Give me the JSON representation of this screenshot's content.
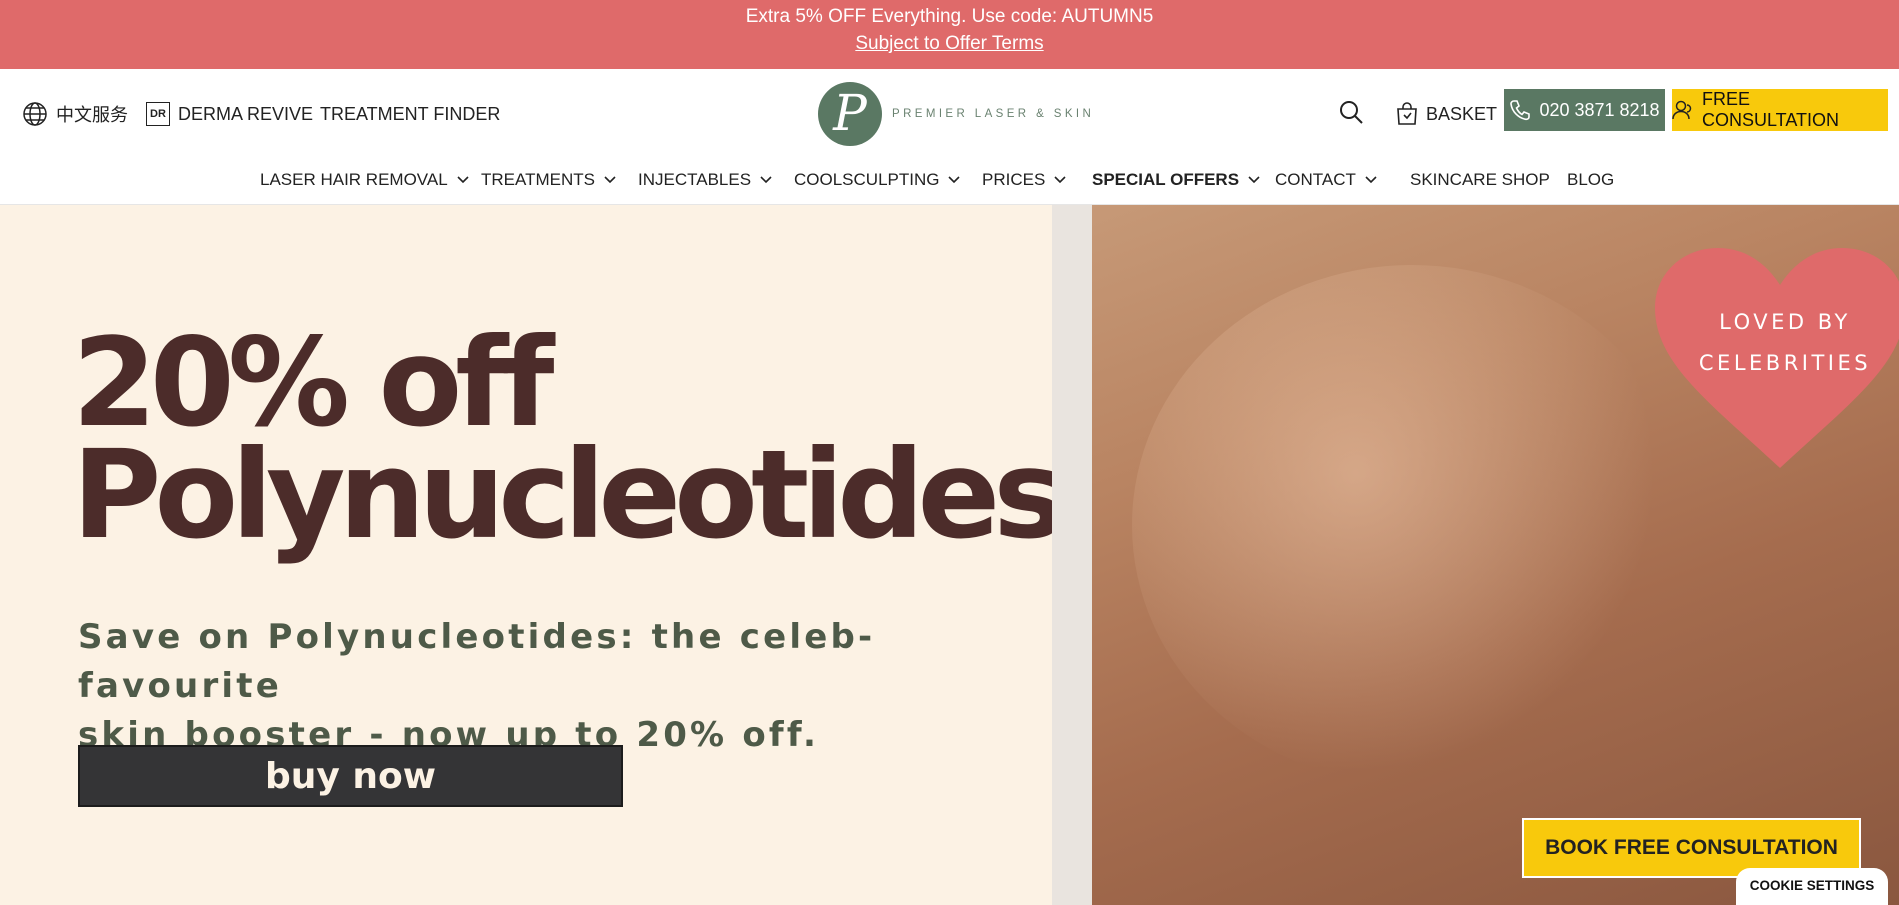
{
  "promo": {
    "line1": "Extra 5% OFF Everything. Use code: AUTUMN5",
    "line2": "Subject to Offer Terms"
  },
  "header": {
    "language_label": "中文服务",
    "derma_badge": "DR",
    "derma_label": "DERMA REVIVE",
    "treatment_finder": "TREATMENT FINDER",
    "logo_letter": "P",
    "logo_text": "PREMIER LASER & SKIN",
    "basket_label": "BASKET",
    "phone_label": "020 3871 8218",
    "consultation_label": "FREE CONSULTATION"
  },
  "nav": {
    "items": [
      {
        "label": "LASER HAIR REMOVAL",
        "has_dropdown": true
      },
      {
        "label": "TREATMENTS",
        "has_dropdown": true
      },
      {
        "label": "INJECTABLES",
        "has_dropdown": true
      },
      {
        "label": "COOLSCULPTING",
        "has_dropdown": true
      },
      {
        "label": "PRICES",
        "has_dropdown": true
      },
      {
        "label": "SPECIAL OFFERS",
        "has_dropdown": true
      },
      {
        "label": "CONTACT",
        "has_dropdown": true
      },
      {
        "label": "SKINCARE SHOP",
        "has_dropdown": false
      },
      {
        "label": "BLOG",
        "has_dropdown": false
      }
    ]
  },
  "hero": {
    "title_line1": "20% off",
    "title_line2": "Polynucleotides",
    "subtitle_line1": "Save on Polynucleotides: the celeb-favourite",
    "subtitle_line2": "skin booster - now up to 20% off.",
    "buy_label": "buy now",
    "heart_line1": "LOVED BY",
    "heart_line2": "CELEBRITIES"
  },
  "floating": {
    "book_label": "BOOK FREE CONSULTATION",
    "cookie_label": "COOKIE SETTINGS"
  },
  "colors": {
    "promo_bg": "#df6a6a",
    "brand_green": "#5a7863",
    "accent_yellow": "#f8c90c",
    "hero_bg": "#fcf2e4",
    "hero_title": "#4c2c2a",
    "heart": "#df6a6a"
  },
  "icons": {
    "language": "globe-icon",
    "search": "search-icon",
    "basket": "shopping-bag-icon",
    "phone": "phone-icon",
    "consultation": "user-icon",
    "dropdown": "chevron-down-icon"
  }
}
